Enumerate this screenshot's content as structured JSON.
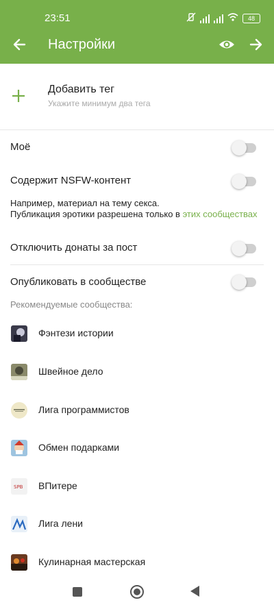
{
  "status_bar": {
    "time": "23:51",
    "battery": "48"
  },
  "app_bar": {
    "title": "Настройки",
    "back_icon": "arrow-left-icon",
    "eye_icon": "eye-icon",
    "forward_icon": "arrow-right-icon"
  },
  "add_tag": {
    "label": "Добавить тег",
    "hint": "Укажите минимум два тега"
  },
  "settings": {
    "mine": {
      "label": "Моё",
      "enabled": false
    },
    "nsfw": {
      "label": "Содержит NSFW-контент",
      "enabled": false
    },
    "nsfw_note_line1": "Например, материал на тему секса.",
    "nsfw_note_line2": "Публикация эротики разрешена только в ",
    "nsfw_note_link": "этих сообществах",
    "donations": {
      "label": "Отключить донаты за пост",
      "enabled": false
    },
    "publish_community": {
      "label": "Опубликовать в сообществе",
      "enabled": false
    }
  },
  "recommended": {
    "title": "Рекомендуемые сообщества:",
    "items": [
      {
        "name": "Фэнтези истории",
        "avatar_color": "#3a3a4a"
      },
      {
        "name": "Швейное дело",
        "avatar_color": "#8a8a6a"
      },
      {
        "name": "Лига программистов",
        "avatar_color": "#e8e0c0"
      },
      {
        "name": "Обмен подарками",
        "avatar_color": "#c94a3a"
      },
      {
        "name": "ВПитере",
        "avatar_color": "#f2f2f2"
      },
      {
        "name": "Лига лени",
        "avatar_color": "#5a8ad0"
      },
      {
        "name": "Кулинарная мастерская",
        "avatar_color": "#6a3a20"
      }
    ]
  },
  "colors": {
    "accent": "#78b04a"
  }
}
